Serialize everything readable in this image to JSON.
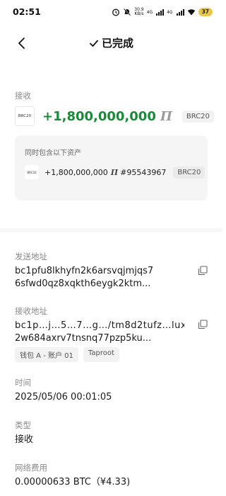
{
  "status_bar": {
    "time": "02:51",
    "net_speed_value": "30.9",
    "net_speed_unit": "KB/s",
    "sig1": "4G",
    "sig2": "4G",
    "battery": "37"
  },
  "header": {
    "title": "已完成"
  },
  "receive": {
    "label": "接收",
    "token_logo": "BRC20",
    "amount": "+1,800,000,000",
    "symbol": "Π",
    "tag": "BRC20"
  },
  "assets": {
    "title": "同时包含以下资产",
    "items": [
      {
        "logo": "BRC20",
        "amount": "+1,800,000,000",
        "symbol": "Π",
        "id": "#95543967",
        "tag": "BRC20"
      }
    ]
  },
  "sender": {
    "label": "发送地址",
    "line1": "bc1pfu8lkhyfn2k6arsvqjmjqs7",
    "line2": "6sfwd0qz8xqkth6eygk2ktm..."
  },
  "recipient": {
    "label": "接收地址",
    "line1": "bc1p…j…5…7…g…/tm8d2tufz…lux",
    "line2": "2w684axrv7tnsnq77pzp5ku...",
    "tag_wallet": "钱包 A - 账户 01",
    "tag_type": "Taproot"
  },
  "time": {
    "label": "时间",
    "value": "2025/05/06 00:01:05"
  },
  "type": {
    "label": "类型",
    "value": "接收"
  },
  "fee": {
    "label": "网络费用",
    "value": "0.00000633 BTC（¥4.33)"
  },
  "colors": {
    "amount_green": "#1a8a3a",
    "battery_yellow": "#e8c84a",
    "card_bg": "#f5f5f5",
    "label_grey": "#8a8a8a"
  },
  "icons": [
    "back-arrow-icon",
    "check-icon",
    "copy-icon",
    "wifi-icon",
    "signal-icon",
    "alarm-icon",
    "mute-icon"
  ]
}
